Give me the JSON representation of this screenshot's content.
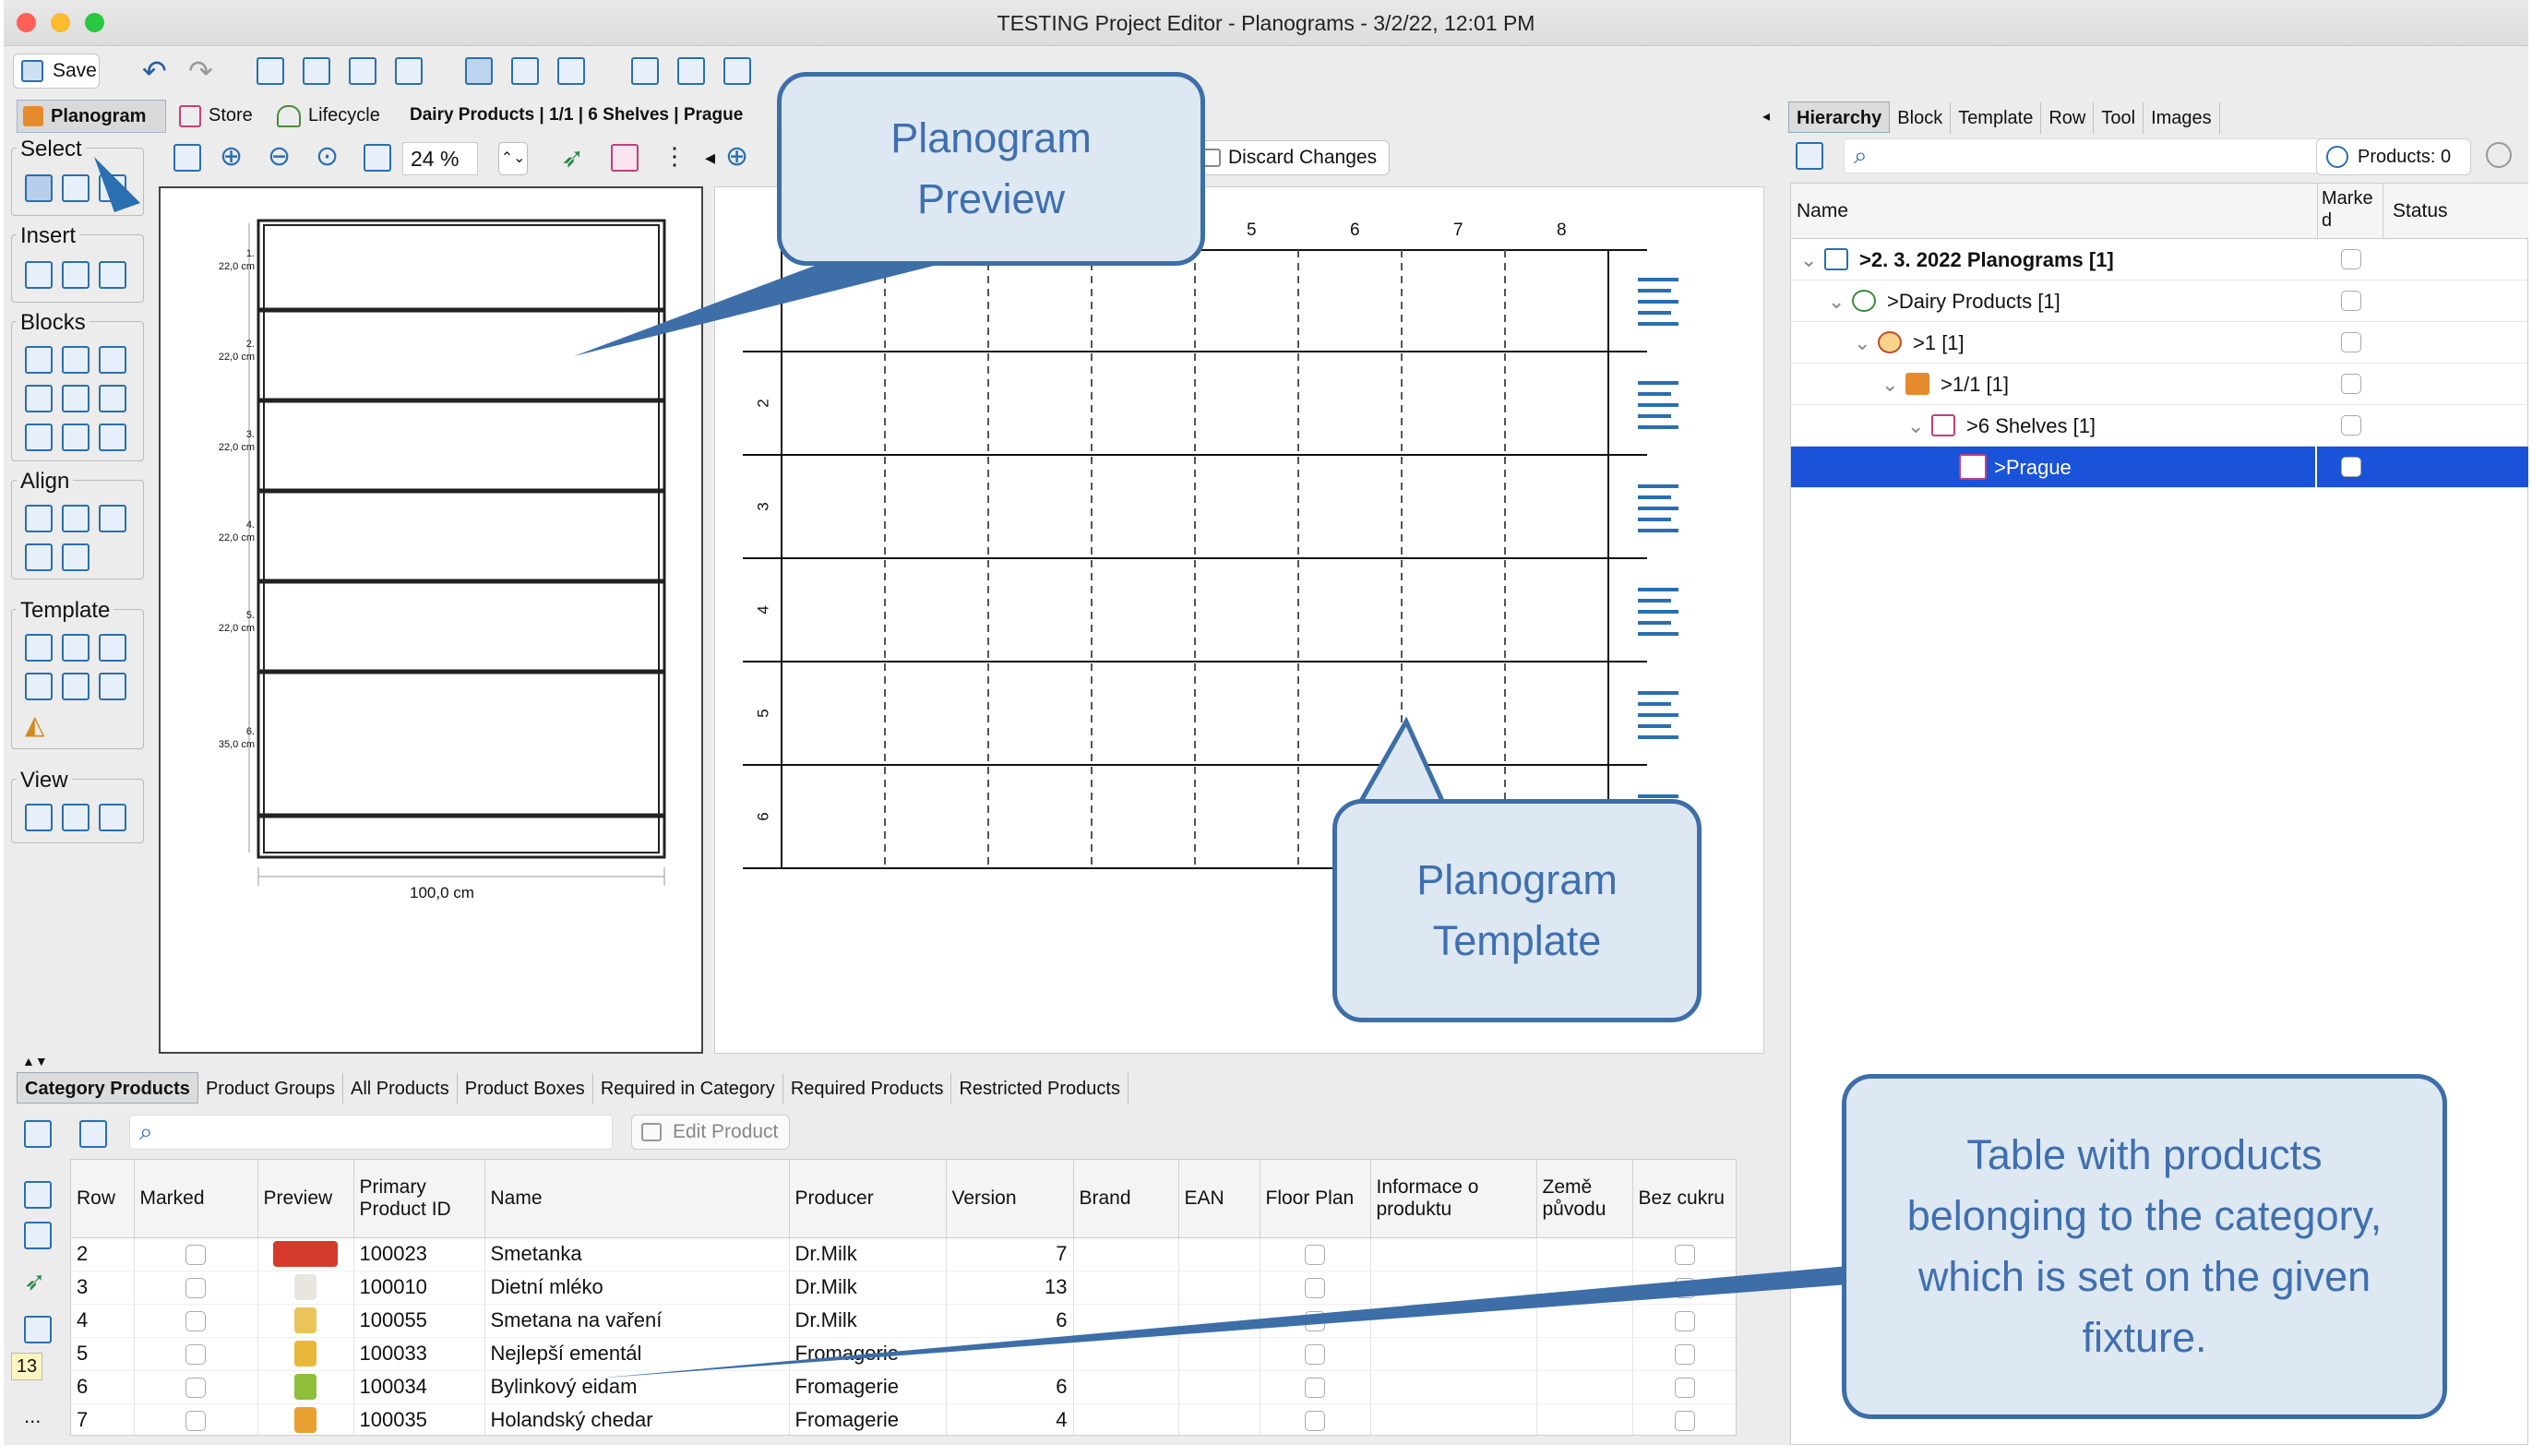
{
  "window": {
    "title": "TESTING Project Editor - Planograms - 3/2/22, 12:01 PM"
  },
  "toolbar": {
    "save_label": "Save"
  },
  "context_tabs": {
    "planogram": "Planogram",
    "store": "Store",
    "lifecycle": "Lifecycle",
    "path": "Dairy Products | 1/1 | 6 Shelves | Prague"
  },
  "palette": {
    "select": "Select",
    "insert": "Insert",
    "blocks": "Blocks",
    "align": "Align",
    "template": "Template",
    "view": "View"
  },
  "zoom": {
    "value": "24 %"
  },
  "discard_label": "Discard Changes",
  "preview": {
    "shelf_numbers": [
      "1.",
      "2.",
      "3.",
      "4.",
      "5.",
      "6."
    ],
    "shelf_heights": [
      "22,0 cm",
      "22,0 cm",
      "22,0 cm",
      "22,0 cm",
      "22,0 cm",
      "35,0 cm"
    ],
    "width_label": "100,0 cm"
  },
  "template_grid": {
    "col_labels": [
      "5",
      "6",
      "7",
      "8"
    ],
    "row_labels": [
      "2",
      "3",
      "4",
      "5",
      "6"
    ]
  },
  "callouts": {
    "preview": "Planogram Preview",
    "template": "Planogram Template",
    "table": "Table with products belonging to the category, which is set on the given fixture."
  },
  "right_tabs": [
    "Hierarchy",
    "Block",
    "Template",
    "Row",
    "Tool",
    "Images"
  ],
  "products_count": "Products: 0",
  "hierarchy": {
    "columns": {
      "name": "Name",
      "marked": "Marke\nd",
      "status": "Status"
    },
    "rows": [
      {
        "label": ">2. 3. 2022 Planograms [1]",
        "bold": true
      },
      {
        "label": ">Dairy Products [1]"
      },
      {
        "label": ">1 [1]"
      },
      {
        "label": ">1/1 [1]"
      },
      {
        "label": ">6 Shelves [1]"
      },
      {
        "label": ">Prague",
        "selected": true
      }
    ]
  },
  "bottom_tabs": [
    "Category Products",
    "Product Groups",
    "All Products",
    "Product Boxes",
    "Required in Category",
    "Required Products",
    "Restricted Products"
  ],
  "edit_product_label": "Edit Product",
  "badge": "13",
  "more": "...",
  "table": {
    "headers": [
      "Row",
      "Marked",
      "Preview",
      "Primary\nProduct ID",
      "Name",
      "Producer",
      "Version",
      "Brand",
      "EAN",
      "Floor Plan",
      "Informace o\nproduktu",
      "Země\npůvodu",
      "Bez cukru"
    ],
    "rows": [
      {
        "row": "2",
        "id": "100023",
        "name": "Smetanka",
        "producer": "Dr.Milk",
        "version": "7"
      },
      {
        "row": "3",
        "id": "100010",
        "name": "Dietní mléko",
        "producer": "Dr.Milk",
        "version": "13"
      },
      {
        "row": "4",
        "id": "100055",
        "name": "Smetana na vaření",
        "producer": "Dr.Milk",
        "version": "6"
      },
      {
        "row": "5",
        "id": "100033",
        "name": "Nejlepší ementál",
        "producer": "Fromagerie",
        "version": ""
      },
      {
        "row": "6",
        "id": "100034",
        "name": "Bylinkový eidam",
        "producer": "Fromagerie",
        "version": "6"
      },
      {
        "row": "7",
        "id": "100035",
        "name": "Holandský chedar",
        "producer": "Fromagerie",
        "version": "4"
      }
    ]
  }
}
